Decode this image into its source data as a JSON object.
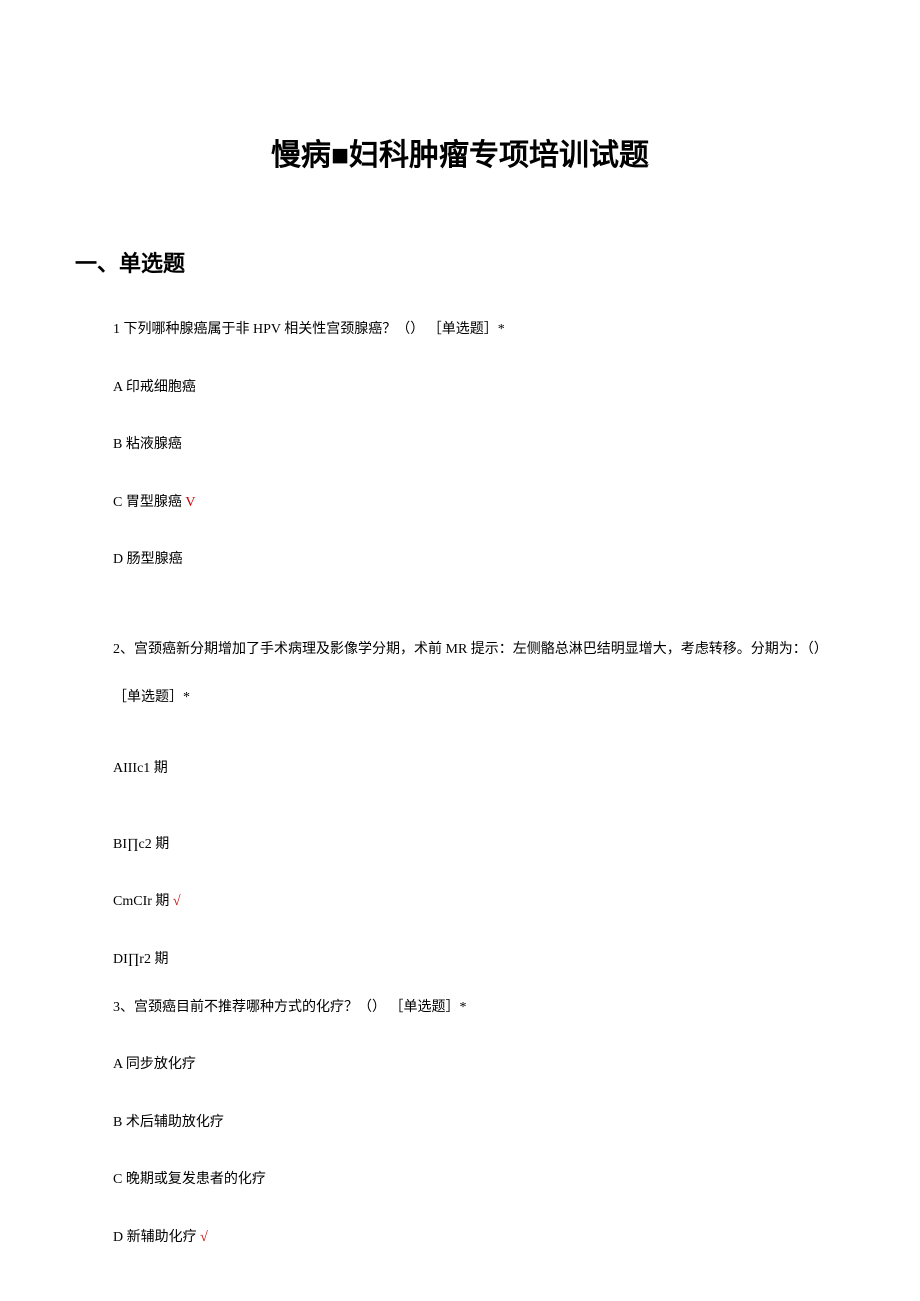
{
  "title": "慢病■妇科肿瘤专项培训试题",
  "sectionHeading": "一、单选题",
  "q1": {
    "text": "1 下列哪种腺癌属于非 HPV 相关性宫颈腺癌？（） ［单选题］*",
    "optA": "A 印戒细胞癌",
    "optB": "B 粘液腺癌",
    "optC": "C 胃型腺癌",
    "optCmark": " V",
    "optD": "D 肠型腺癌"
  },
  "q2": {
    "text": "2、宫颈癌新分期增加了手术病理及影像学分期，术前 MR 提示：左侧骼总淋巴结明显增大，考虑转移。分期为：（） ［单选题］*",
    "optA": "AIIIc1 期",
    "optB": "BI∏c2 期",
    "optC": "CmCIr 期",
    "optCmark": " √",
    "optD": "DI∏r2 期"
  },
  "q3": {
    "text": "3、宫颈癌目前不推荐哪种方式的化疗？（） ［单选题］*",
    "optA": "A 同步放化疗",
    "optB": "B 术后辅助放化疗",
    "optC": "C 晚期或复发患者的化疗",
    "optD": "D 新辅助化疗",
    "optDmark": " √"
  }
}
